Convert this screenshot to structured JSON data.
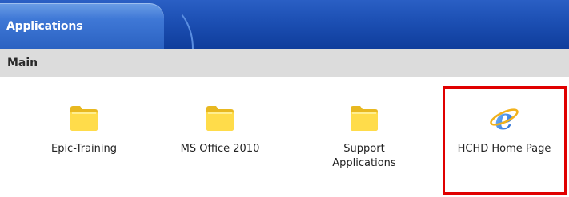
{
  "tabstrip": {
    "active_tab": "Applications"
  },
  "section": {
    "title": "Main"
  },
  "apps": [
    {
      "label_line1": "Epic-Training",
      "label_line2": "",
      "icon": "folder-icon"
    },
    {
      "label_line1": "MS Office 2010",
      "label_line2": "",
      "icon": "folder-icon"
    },
    {
      "label_line1": "Support",
      "label_line2": "Applications",
      "icon": "folder-icon"
    },
    {
      "label_line1": "HCHD Home Page",
      "label_line2": "",
      "icon": "internet-explorer-icon"
    }
  ],
  "colors": {
    "highlight": "#e00000",
    "tab_blue": "#2b62c2"
  }
}
